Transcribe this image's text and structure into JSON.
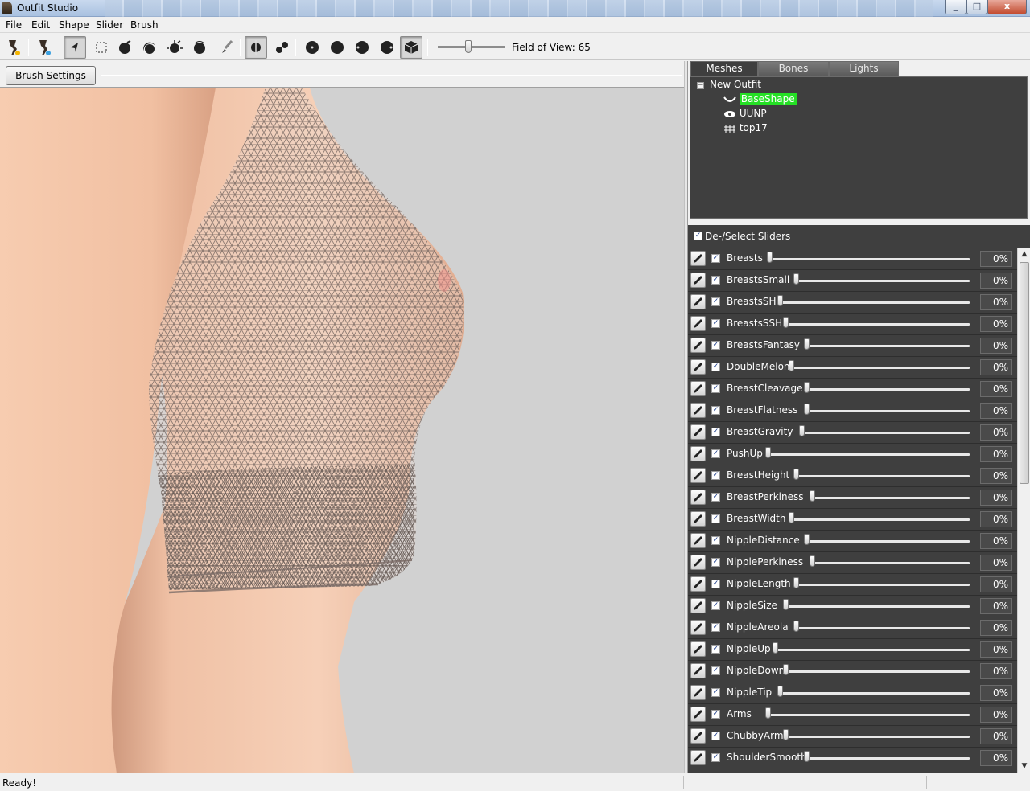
{
  "window": {
    "title": "Outfit Studio",
    "minimize": "_",
    "maximize": "□",
    "close": "x"
  },
  "menu": [
    "File",
    "Edit",
    "Shape",
    "Slider",
    "Brush"
  ],
  "toolbar": {
    "fov_label": "Field of View: 65",
    "fov_value": 65
  },
  "brush_settings_label": "Brush Settings >>",
  "mesh_tabs": [
    "Meshes",
    "Bones",
    "Lights"
  ],
  "mesh_tree": {
    "root": "New Outfit",
    "items": [
      {
        "label": "BaseShape",
        "icon": "reference-icon",
        "selected": true
      },
      {
        "label": "UUNP",
        "icon": "eye-icon",
        "selected": false
      },
      {
        "label": "top17",
        "icon": "grid-icon",
        "selected": false
      }
    ]
  },
  "sliders_header": "De-/Select Sliders",
  "sliders": [
    {
      "name": "Breasts",
      "value": "0%",
      "level": 0.0
    },
    {
      "name": "BreastsSmall",
      "value": "0%",
      "level": 0.0
    },
    {
      "name": "BreastsSH",
      "value": "0%",
      "level": 0.0
    },
    {
      "name": "BreastsSSH",
      "value": "0%",
      "level": 0.0
    },
    {
      "name": "BreastsFantasy",
      "value": "0%",
      "level": 0.0
    },
    {
      "name": "DoubleMelon",
      "value": "0%",
      "level": 0.0
    },
    {
      "name": "BreastCleavage",
      "value": "0%",
      "level": 0.0
    },
    {
      "name": "BreastFlatness",
      "value": "0%",
      "level": 0.0
    },
    {
      "name": "BreastGravity",
      "value": "0%",
      "level": 0.0
    },
    {
      "name": "PushUp",
      "value": "0%",
      "level": 0.0
    },
    {
      "name": "BreastHeight",
      "value": "0%",
      "level": 0.0
    },
    {
      "name": "BreastPerkiness",
      "value": "0%",
      "level": 0.0
    },
    {
      "name": "BreastWidth",
      "value": "0%",
      "level": 0.0
    },
    {
      "name": "NippleDistance",
      "value": "0%",
      "level": 0.0
    },
    {
      "name": "NipplePerkiness",
      "value": "0%",
      "level": 0.0
    },
    {
      "name": "NippleLength",
      "value": "0%",
      "level": 0.0
    },
    {
      "name": "NippleSize",
      "value": "0%",
      "level": 0.0
    },
    {
      "name": "NippleAreola",
      "value": "0%",
      "level": 0.0
    },
    {
      "name": "NippleUp",
      "value": "0%",
      "level": 0.0
    },
    {
      "name": "NippleDown",
      "value": "0%",
      "level": 0.0
    },
    {
      "name": "NippleTip",
      "value": "0%",
      "level": 0.0
    },
    {
      "name": "Arms",
      "value": "0%",
      "level": 0.0
    },
    {
      "name": "ChubbyArms",
      "value": "0%",
      "level": 0.0
    },
    {
      "name": "ShoulderSmooth",
      "value": "0%",
      "level": 0.0
    }
  ],
  "status": "Ready!",
  "colors": {
    "panel_bg": "#3f3f3f",
    "selected_mesh": "#25e025",
    "viewport_bg": "#d1d1d1",
    "skin": "#f2c1a4"
  }
}
